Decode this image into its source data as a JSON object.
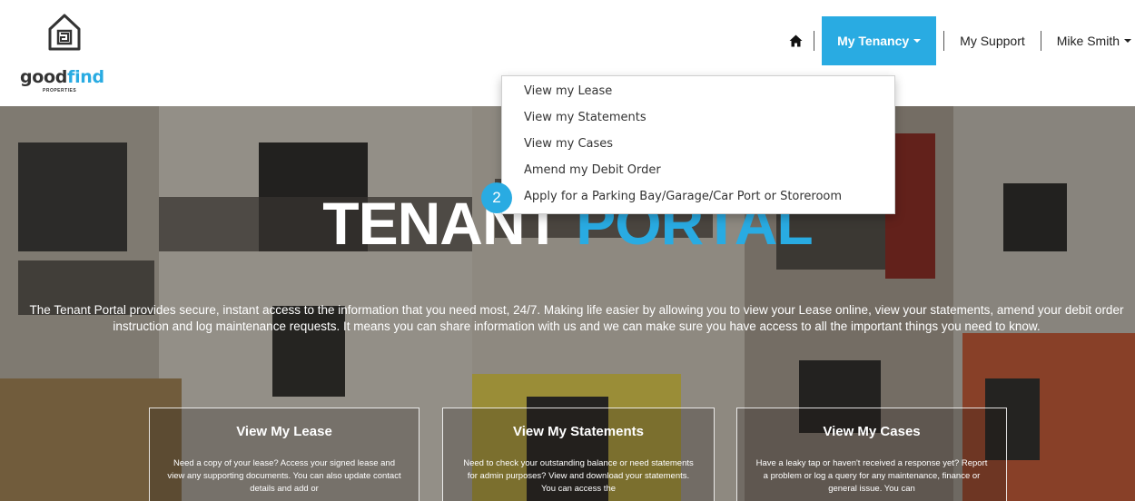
{
  "brand": {
    "name_main": "good",
    "name_accent": "find",
    "sub": "PROPERTIES",
    "accent_color": "#29abe2"
  },
  "nav": {
    "home_icon": "home-icon",
    "tenancy_label": "My Tenancy",
    "support_label": "My Support",
    "user_label": "Mike Smith"
  },
  "dropdown": {
    "items": [
      "View my Lease",
      "View my Statements",
      "View my Cases",
      "Amend my Debit Order",
      "Apply for a Parking Bay/Garage/Car Port or Storeroom"
    ]
  },
  "step_badge": "2",
  "hero": {
    "title_white": "TENANT",
    "title_blue": "PORTAL",
    "description": "The Tenant Portal provides secure, instant access to the information that you need most, 24/7. Making life easier by allowing you to view your Lease online, view your statements, amend your debit order instruction and log maintenance requests. It means you can share information with us and we can make sure you have access to all the important things you need to know."
  },
  "cards": [
    {
      "title": "View My Lease",
      "text": "Need a copy of your lease? Access your signed lease and view any supporting documents. You can also update contact details and add or"
    },
    {
      "title": "View My Statements",
      "text": "Need to check your outstanding balance or need statements for admin purposes? View and download your statements. You can access the"
    },
    {
      "title": "View My Cases",
      "text": "Have a leaky tap or haven't received a response yet? Report a problem or log a query for any maintenance, finance or general issue. You can"
    }
  ]
}
